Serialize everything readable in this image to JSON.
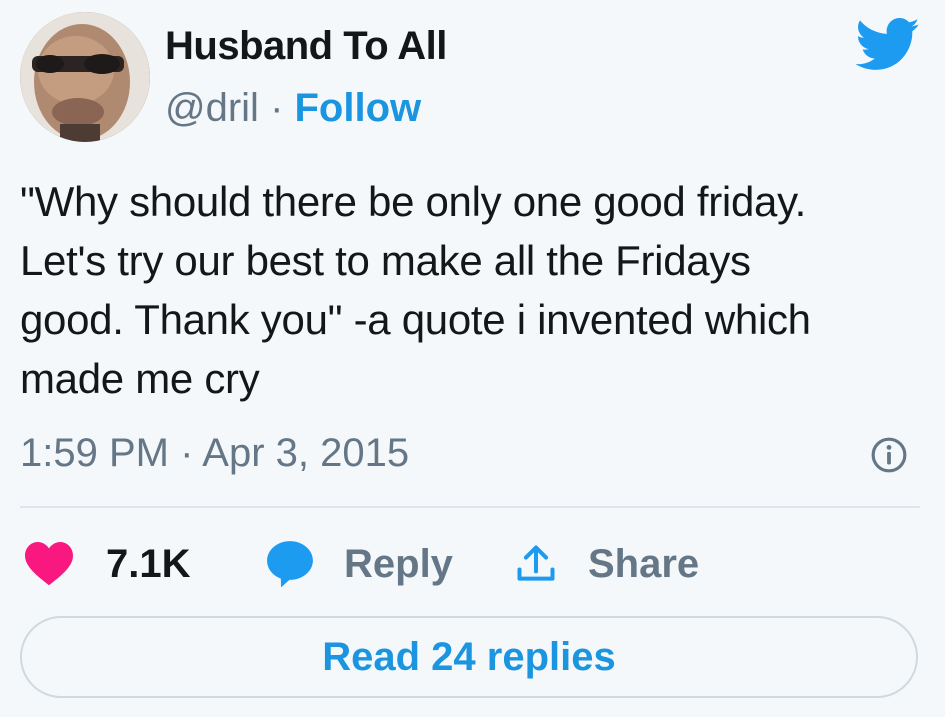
{
  "author": {
    "display_name": "Husband To All",
    "handle": "@dril",
    "separator": " · ",
    "follow_label": "Follow",
    "avatar_icon": "avatar-photo"
  },
  "tweet": {
    "text": "\"Why should there be only one good friday.\nLet's try our best to make all the Fridays\ngood. Thank you\" -a quote i invented which\nmade me cry",
    "timestamp": "1:59 PM · Apr 3, 2015"
  },
  "actions": {
    "like_count": "7.1K",
    "reply_label": "Reply",
    "share_label": "Share"
  },
  "read_replies_label": "Read 24 replies",
  "colors": {
    "accent": "#1b95e0",
    "like": "#f91880",
    "reply_icon": "#1d9bf0",
    "secondary_text": "#657786",
    "background": "#f5f8fa"
  },
  "icons": {
    "logo": "twitter-bird-icon",
    "info": "info-icon",
    "like": "heart-icon",
    "reply": "speech-bubble-icon",
    "share": "share-upload-icon"
  }
}
